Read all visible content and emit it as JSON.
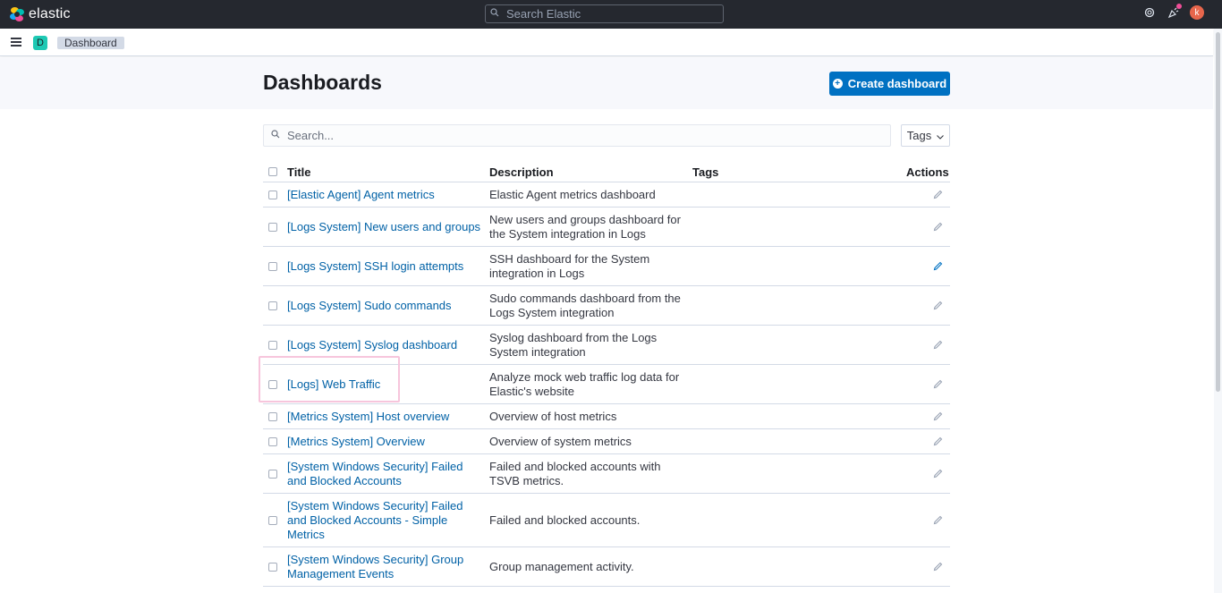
{
  "header": {
    "brand": "elastic",
    "search_placeholder": "Search Elastic",
    "avatar_initial": "k"
  },
  "breadcrumb": {
    "space_initial": "D",
    "current": "Dashboard"
  },
  "page": {
    "title": "Dashboards",
    "create_button": "Create dashboard",
    "search_placeholder": "Search...",
    "tags_filter": "Tags"
  },
  "table": {
    "columns": {
      "title": "Title",
      "description": "Description",
      "tags": "Tags",
      "actions": "Actions"
    },
    "rows": [
      {
        "title": "[Elastic Agent] Agent metrics",
        "description": "Elastic Agent metrics dashboard"
      },
      {
        "title": "[Logs System] New users and groups",
        "description": "New users and groups dashboard for the System integration in Logs"
      },
      {
        "title": "[Logs System] SSH login attempts",
        "description": "SSH dashboard for the System integration in Logs"
      },
      {
        "title": "[Logs System] Sudo commands",
        "description": "Sudo commands dashboard from the Logs System integration"
      },
      {
        "title": "[Logs System] Syslog dashboard",
        "description": "Syslog dashboard from the Logs System integration"
      },
      {
        "title": "[Logs] Web Traffic",
        "description": "Analyze mock web traffic log data for Elastic's website"
      },
      {
        "title": "[Metrics System] Host overview",
        "description": "Overview of host metrics"
      },
      {
        "title": "[Metrics System] Overview",
        "description": "Overview of system metrics"
      },
      {
        "title": "[System Windows Security] Failed and Blocked Accounts",
        "description": "Failed and blocked accounts with TSVB metrics."
      },
      {
        "title": "[System Windows Security] Failed and Blocked Accounts - Simple Metrics",
        "description": "Failed and blocked accounts."
      },
      {
        "title": "[System Windows Security] Group Management Events",
        "description": "Group management activity."
      }
    ]
  },
  "colors": {
    "header_bg": "#25282f",
    "link": "#0061a6",
    "primary_button": "#0071c2",
    "space_badge": "#1ec9b4",
    "notification_dot": "#f04e98",
    "highlight_border": "#f7c5dc"
  }
}
